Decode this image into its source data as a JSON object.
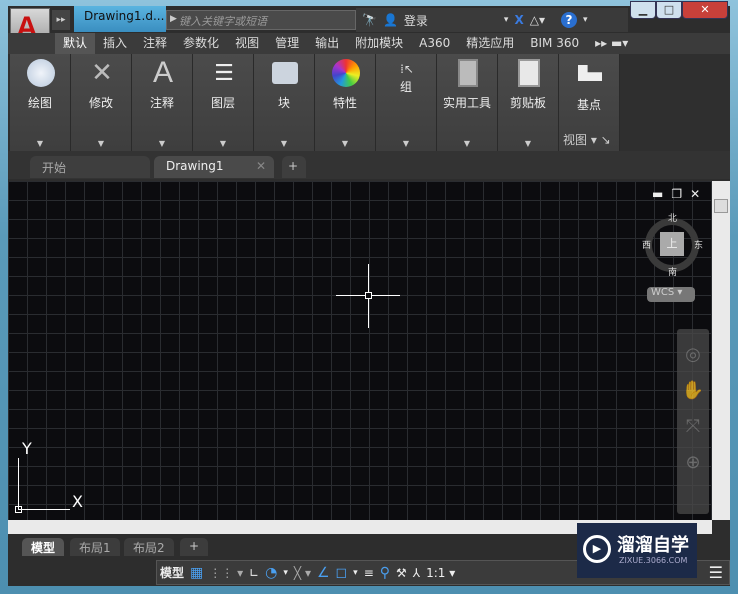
{
  "title": {
    "doc_tab": "Drawing1.d...",
    "search_placeholder": "键入关键字或短语",
    "login": "登录"
  },
  "ribbon_tabs": [
    "默认",
    "插入",
    "注释",
    "参数化",
    "视图",
    "管理",
    "输出",
    "附加模块",
    "A360",
    "精选应用",
    "BIM 360"
  ],
  "panels": [
    {
      "label": "绘图",
      "icon": "draw-circle-icon"
    },
    {
      "label": "修改",
      "icon": "modify-icon"
    },
    {
      "label": "注释",
      "icon": "text-icon"
    },
    {
      "label": "图层",
      "icon": "layers-icon"
    },
    {
      "label": "块",
      "icon": "block-icon"
    },
    {
      "label": "特性",
      "icon": "color-wheel-icon"
    },
    {
      "label": "组",
      "icon": "group-icon"
    },
    {
      "label": "实用工具",
      "icon": "calculator-icon"
    },
    {
      "label": "剪贴板",
      "icon": "clipboard-icon"
    },
    {
      "label": "基点",
      "icon": "base-point-icon"
    }
  ],
  "view_panel": "视图",
  "file_tabs": {
    "start": "开始",
    "drawing": "Drawing1"
  },
  "viewcube": {
    "north": "北",
    "south": "南",
    "east": "东",
    "west": "西",
    "face": "上",
    "wcs": "WCS"
  },
  "ucs": {
    "x": "X",
    "y": "Y"
  },
  "layout_tabs": [
    "模型",
    "布局1",
    "布局2"
  ],
  "status": {
    "model": "模型",
    "scale": "1:1"
  },
  "watermark": {
    "name": "溜溜自学",
    "url": "ZIXUE.3066.COM"
  }
}
